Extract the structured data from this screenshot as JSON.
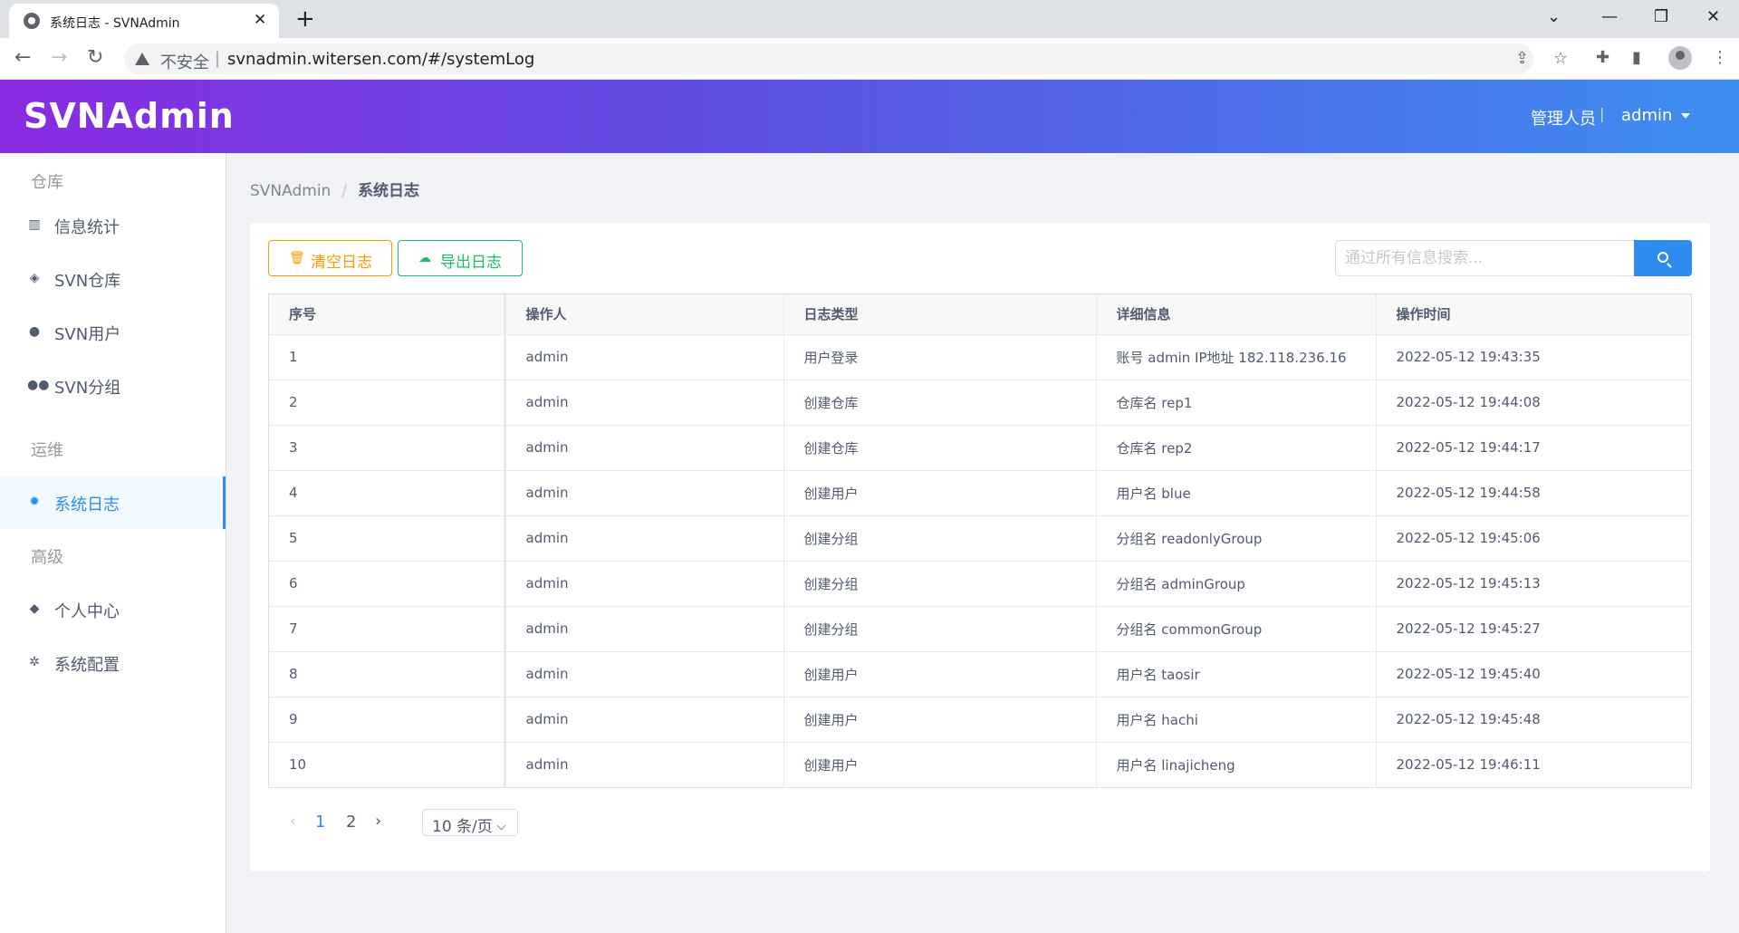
{
  "browser": {
    "tab_title": "系统日志 - SVNAdmin",
    "tab_close": "✕",
    "new_tab": "+",
    "security_label": "不安全",
    "url": "svnadmin.witersen.com/#/systemLog"
  },
  "header": {
    "logo": "SVNAdmin",
    "role": "管理人员",
    "separator": "|",
    "user": "admin"
  },
  "sidebar": {
    "groups": [
      "仓库",
      "运维",
      "高级"
    ],
    "items": [
      {
        "label": "信息统计",
        "icon": "bar-chart-icon"
      },
      {
        "label": "SVN仓库",
        "icon": "layers-icon"
      },
      {
        "label": "SVN用户",
        "icon": "user-icon"
      },
      {
        "label": "SVN分组",
        "icon": "users-icon"
      },
      {
        "label": "系统日志",
        "icon": "bug-icon"
      },
      {
        "label": "个人中心",
        "icon": "cube-icon"
      },
      {
        "label": "系统配置",
        "icon": "gear-icon"
      }
    ],
    "active": "系统日志"
  },
  "breadcrumb": {
    "root": "SVNAdmin",
    "separator": "/",
    "current": "系统日志"
  },
  "toolbar": {
    "clear_label": "清空日志",
    "export_label": "导出日志",
    "search_placeholder": "通过所有信息搜索..."
  },
  "table": {
    "columns": [
      "序号",
      "操作人",
      "日志类型",
      "详细信息",
      "操作时间"
    ],
    "rows": [
      [
        "1",
        "admin",
        "用户登录",
        "账号 admin IP地址 182.118.236.16",
        "2022-05-12 19:43:35"
      ],
      [
        "2",
        "admin",
        "创建仓库",
        "仓库名 rep1",
        "2022-05-12 19:44:08"
      ],
      [
        "3",
        "admin",
        "创建仓库",
        "仓库名 rep2",
        "2022-05-12 19:44:17"
      ],
      [
        "4",
        "admin",
        "创建用户",
        "用户名 blue",
        "2022-05-12 19:44:58"
      ],
      [
        "5",
        "admin",
        "创建分组",
        "分组名 readonlyGroup",
        "2022-05-12 19:45:06"
      ],
      [
        "6",
        "admin",
        "创建分组",
        "分组名 adminGroup",
        "2022-05-12 19:45:13"
      ],
      [
        "7",
        "admin",
        "创建分组",
        "分组名 commonGroup",
        "2022-05-12 19:45:27"
      ],
      [
        "8",
        "admin",
        "创建用户",
        "用户名 taosir",
        "2022-05-12 19:45:40"
      ],
      [
        "9",
        "admin",
        "创建用户",
        "用户名 hachi",
        "2022-05-12 19:45:48"
      ],
      [
        "10",
        "admin",
        "创建用户",
        "用户名 linajicheng",
        "2022-05-12 19:46:11"
      ]
    ]
  },
  "pagination": {
    "prev": "‹",
    "next": "›",
    "pages": [
      "1",
      "2"
    ],
    "current_page": "1",
    "page_size": "10 条/页"
  },
  "colors": {
    "primary": "#2d8cf0",
    "warning": "#ff9900",
    "success": "#19be6b",
    "header_gradient_start": "#8a2be2",
    "header_gradient_end": "#3d8ef0"
  }
}
